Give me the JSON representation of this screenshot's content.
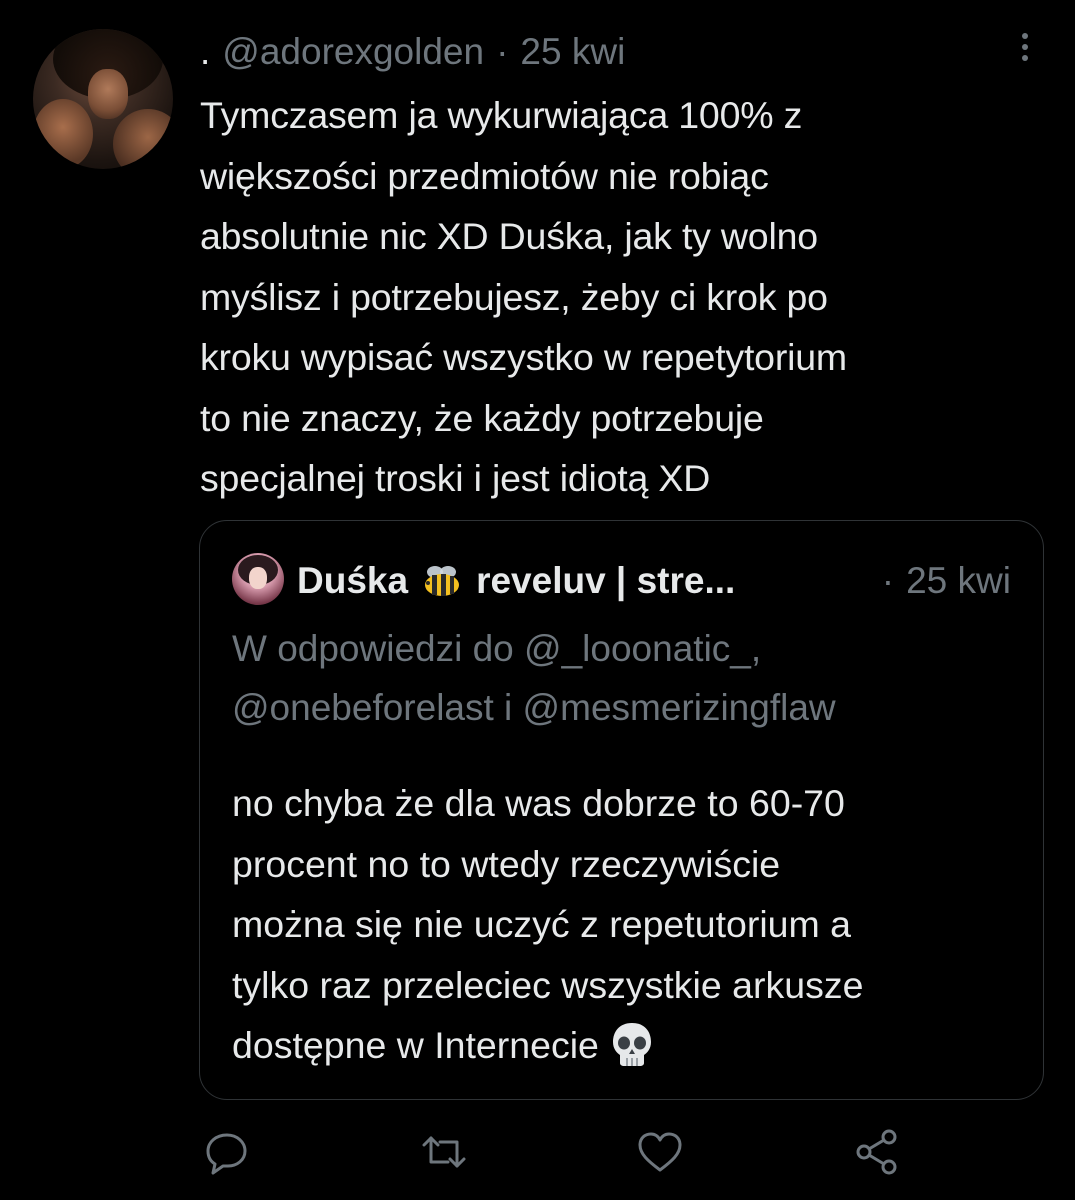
{
  "tweet": {
    "author_prefix": ".",
    "handle": "@adorexgolden",
    "separator": "·",
    "time": "25 kwi",
    "text_lines": [
      "Tymczasem ja wykurwiająca 100% z",
      "większości przedmiotów nie robiąc",
      "absolutnie nic XD Duśka, jak ty wolno",
      "myślisz i potrzebujesz, żeby ci krok po",
      "kroku wypisać wszystko w repetytorium",
      "to nie znaczy, że każdy potrzebuje",
      "specjalnej troski i jest idiotą XD"
    ]
  },
  "quote": {
    "name": "Duśka",
    "name_emoji": "bee-emoji",
    "display_suffix": "reveluv | stre...",
    "separator": "·",
    "time": "25 kwi",
    "reply_lines": [
      "W odpowiedzi do @_looonatic_,",
      "@onebeforelast i @mesmerizingflaw"
    ],
    "text_lines": [
      "no chyba że dla was dobrze to 60-70",
      "procent no to wtedy rzeczywiście",
      "można się nie uczyć z repetutorium a",
      "tylko raz przeleciec wszystkie arkusze",
      "dostępne w Internecie"
    ],
    "trailing_emoji": "skull-emoji"
  },
  "actions": {
    "icons": [
      "reply-icon",
      "retweet-icon",
      "like-icon",
      "share-icon"
    ]
  },
  "colors": {
    "background": "#000000",
    "primary_text": "#e7e9ea",
    "secondary_text": "#6e767d",
    "border": "#2f3336"
  }
}
